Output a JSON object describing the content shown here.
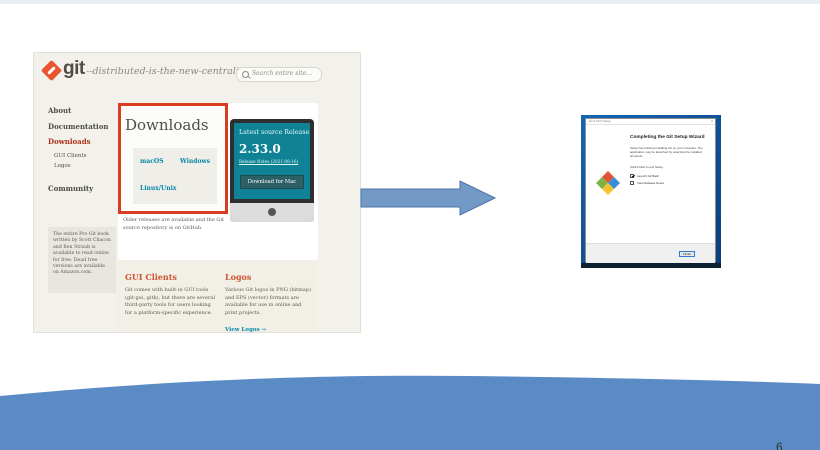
{
  "git_site": {
    "logo_text": "git",
    "tagline": "--distributed-is-the-new-centralized",
    "search_placeholder": "Search entire site...",
    "nav": {
      "about": "About",
      "documentation": "Documentation",
      "downloads": "Downloads",
      "gui_clients": "GUI Clients",
      "logos": "Logos",
      "community": "Community"
    },
    "pro_git_text": "The entire Pro Git book written by Scott Chacon and Ben Straub is available to read online for free. Dead tree versions are available on Amazon.com.",
    "downloads_title": "Downloads",
    "platforms": {
      "mac": "macOS",
      "windows": "Windows",
      "linux": "Linux/Unix"
    },
    "latest_release_label": "Latest source Release",
    "latest_version": "2.33.0",
    "release_notes": "Release Notes (2021-08-16)",
    "download_mac_button": "Download for Mac",
    "older_releases_text": "Older releases are available and the Git source repository is on GitHub.",
    "gui_clients_title": "GUI Clients",
    "gui_clients_desc": "Git comes with built-in GUI tools (git-gui, gitk), but there are several third-party tools for users looking for a platform-specific experience.",
    "logos_title": "Logos",
    "logos_desc": "Various Git logos in PNG (bitmap) and EPS (vector) formats are available for use in online and print projects.",
    "view_logos_link": "View Logos →"
  },
  "wizard": {
    "window_title": "Git 2.33.0 Setup",
    "close_glyph": "×",
    "heading": "Completing the Git Setup Wizard",
    "body": "Setup has finished installing Git on your computer. The application may be launched by selecting the installed shortcuts.",
    "finish_note": "Click Finish to exit Setup.",
    "checkbox_launch_bash": "Launch Git Bash",
    "checkbox_release_notes": "View Release Notes",
    "launch_bash_checked": true,
    "release_notes_checked": false,
    "finish_button": "Finish"
  },
  "slide": {
    "page_number": "6",
    "arrow_color": "#7399c6",
    "wave_color": "#5b8bc5"
  }
}
